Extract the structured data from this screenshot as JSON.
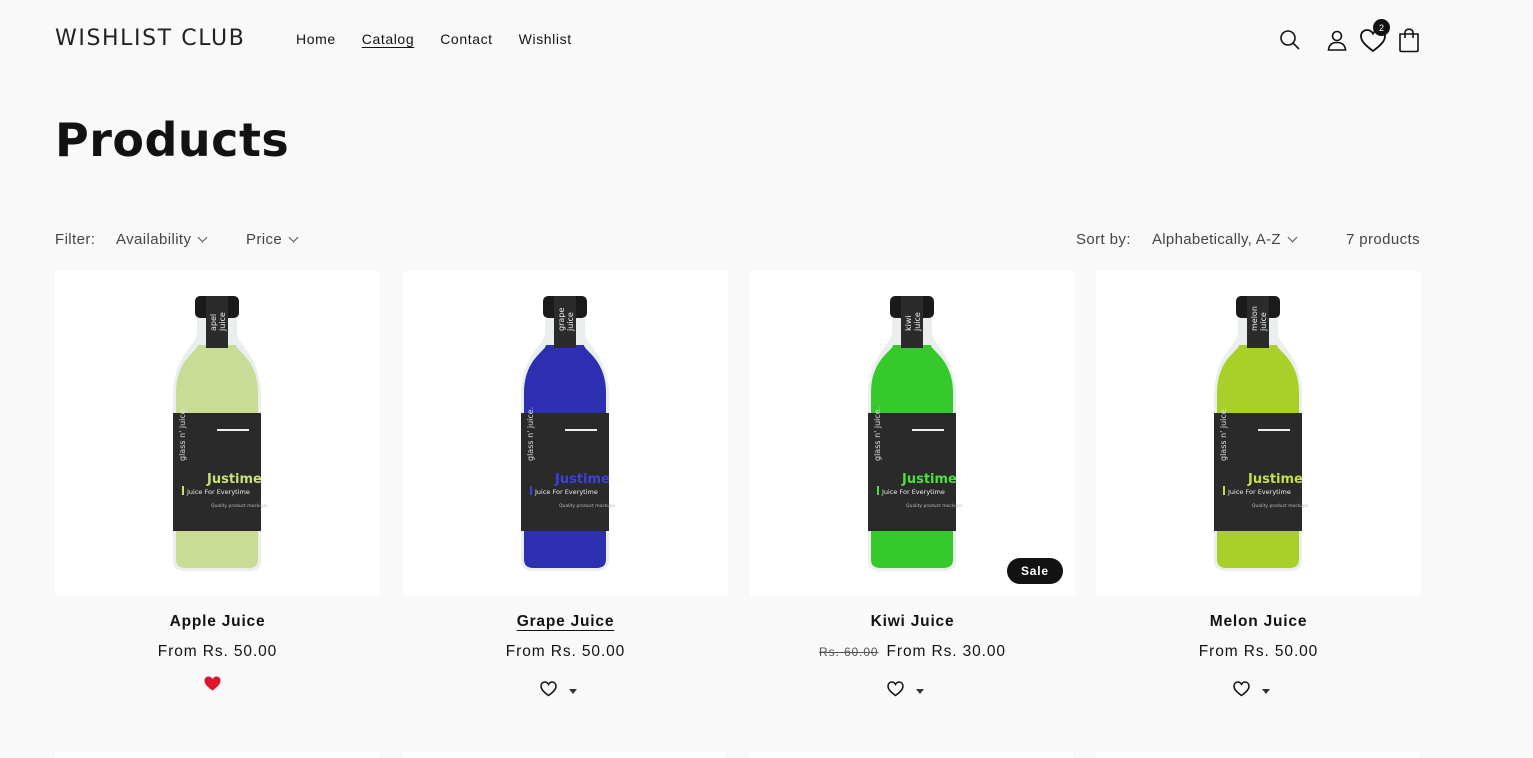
{
  "header": {
    "logo": "WISHLIST CLUB",
    "nav": [
      "Home",
      "Catalog",
      "Contact",
      "Wishlist"
    ],
    "active_nav": "Catalog",
    "wishlist_count": "2",
    "icons": [
      "search-icon",
      "account-icon",
      "wishlist-heart-icon",
      "cart-icon"
    ]
  },
  "page": {
    "title": "Products"
  },
  "toolbar": {
    "filter_label": "Filter:",
    "filters": [
      "Availability",
      "Price"
    ],
    "sort_label": "Sort by:",
    "sort_value": "Alphabetically, A-Z",
    "product_count": "7 products"
  },
  "products": [
    {
      "title": "Apple Juice",
      "price": "From Rs. 50.00",
      "compare_price": "",
      "sale": false,
      "wishlisted": true,
      "liquid_color": "#c9dc96",
      "accent": "#c8e07a",
      "label_top": "apel",
      "label_bottom": "juice"
    },
    {
      "title": "Grape Juice",
      "price": "From Rs. 50.00",
      "compare_price": "",
      "sale": false,
      "wishlisted": false,
      "liquid_color": "#2b2fb0",
      "accent": "#3c40e0",
      "label_top": "grape",
      "label_bottom": "juice"
    },
    {
      "title": "Kiwi Juice",
      "price": "From Rs. 30.00",
      "compare_price": "Rs. 60.00",
      "sale": true,
      "sale_label": "Sale",
      "wishlisted": false,
      "liquid_color": "#35c92c",
      "accent": "#4be03c",
      "label_top": "kiwi",
      "label_bottom": "juice"
    },
    {
      "title": "Melon Juice",
      "price": "From Rs. 50.00",
      "compare_price": "",
      "sale": false,
      "wishlisted": false,
      "liquid_color": "#a8d028",
      "accent": "#c2e048",
      "label_top": "melon",
      "label_bottom": "juice"
    }
  ],
  "bottle_label": {
    "brand": "glass n' juice.",
    "name": "Justime",
    "tagline": "Juice For Everytime",
    "small": "Quality product mockups"
  },
  "colors": {
    "text": "#121212",
    "background": "#f9f9f9",
    "wishlisted_heart": "#e0142a"
  }
}
